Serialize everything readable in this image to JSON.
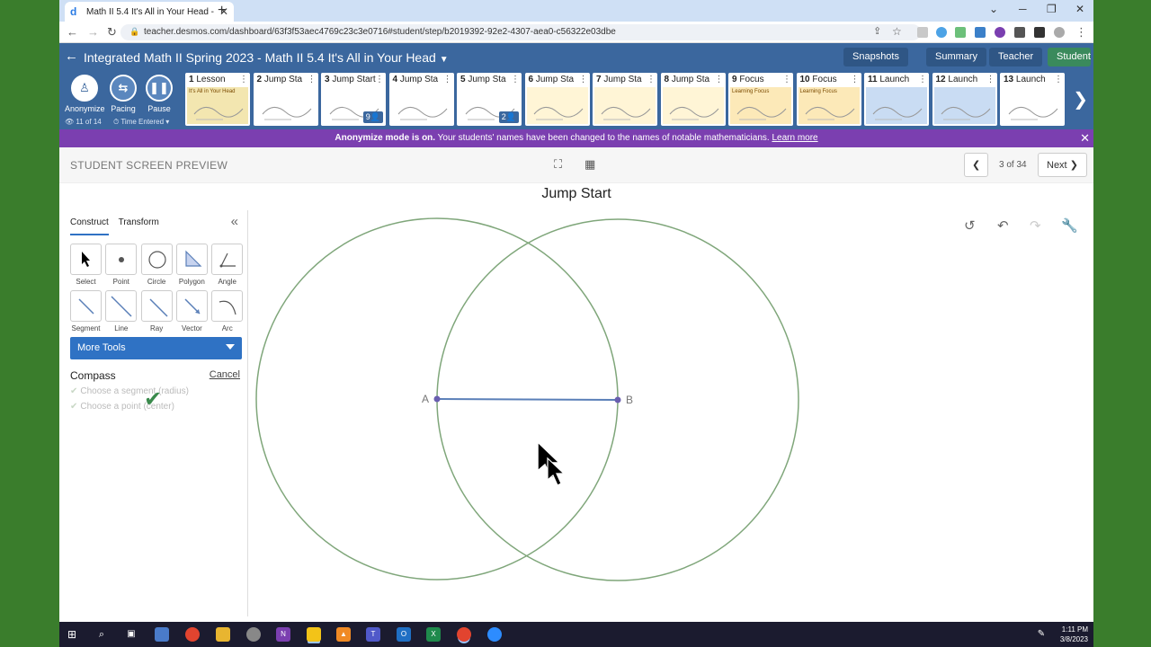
{
  "browser": {
    "tab_title": "Math II 5.4 It's All in Your Head -",
    "url": "teacher.desmos.com/dashboard/63f3f53aec4769c23c3e0716#student/step/b2019392-92e2-4307-aea0-c56322e03dbe"
  },
  "header": {
    "activity_title": "Integrated Math II Spring 2023 - Math II 5.4 It's All in Your Head",
    "buttons": [
      "Snapshots",
      "Summary",
      "Teacher",
      "Student"
    ],
    "active_button": "Student"
  },
  "controls": {
    "anonymize": "Anonymize",
    "pacing": "Pacing",
    "pause": "Pause",
    "progress": "11 of 14",
    "sort": "Time Entered"
  },
  "screens": [
    {
      "num": "1",
      "label": "Lesson",
      "subtitle": "It's All in Your Head"
    },
    {
      "num": "2",
      "label": "Jump Sta"
    },
    {
      "num": "3",
      "label": "Jump Start",
      "badge": "9"
    },
    {
      "num": "4",
      "label": "Jump Sta"
    },
    {
      "num": "5",
      "label": "Jump Sta",
      "badge": "2"
    },
    {
      "num": "6",
      "label": "Jump Sta"
    },
    {
      "num": "7",
      "label": "Jump Sta"
    },
    {
      "num": "8",
      "label": "Jump Sta"
    },
    {
      "num": "9",
      "label": "Focus",
      "subtitle": "Learning Focus"
    },
    {
      "num": "10",
      "label": "Focus",
      "subtitle": "Learning Focus"
    },
    {
      "num": "11",
      "label": "Launch"
    },
    {
      "num": "12",
      "label": "Launch"
    },
    {
      "num": "13",
      "label": "Launch"
    }
  ],
  "banner": {
    "bold": "Anonymize mode is on.",
    "text": " Your students' names have been changed to the names of notable mathematicians. ",
    "link": "Learn more"
  },
  "preview": {
    "label": "STUDENT SCREEN PREVIEW",
    "count": "3 of 34",
    "next": "Next",
    "screen_title": "Jump Start"
  },
  "panel": {
    "tabs": [
      "Construct",
      "Transform"
    ],
    "tools": [
      "Select",
      "Point",
      "Circle",
      "Polygon",
      "Angle",
      "Segment",
      "Line",
      "Ray",
      "Vector",
      "Arc"
    ],
    "more_tools": "More Tools",
    "compass_title": "Compass",
    "cancel": "Cancel",
    "steps": [
      "Choose a segment (radius)",
      "Choose a point (center)"
    ]
  },
  "canvas": {
    "point_a": "A",
    "point_b": "B"
  },
  "taskbar": {
    "time": "1:11 PM",
    "date": "3/8/2023"
  },
  "colors": {
    "desmos_blue": "#3b679e",
    "banner_purple": "#7b3fb0",
    "circle_green": "#7fa67a",
    "segment_blue": "#5a7fb8",
    "tool_blue": "#2f72c4"
  }
}
